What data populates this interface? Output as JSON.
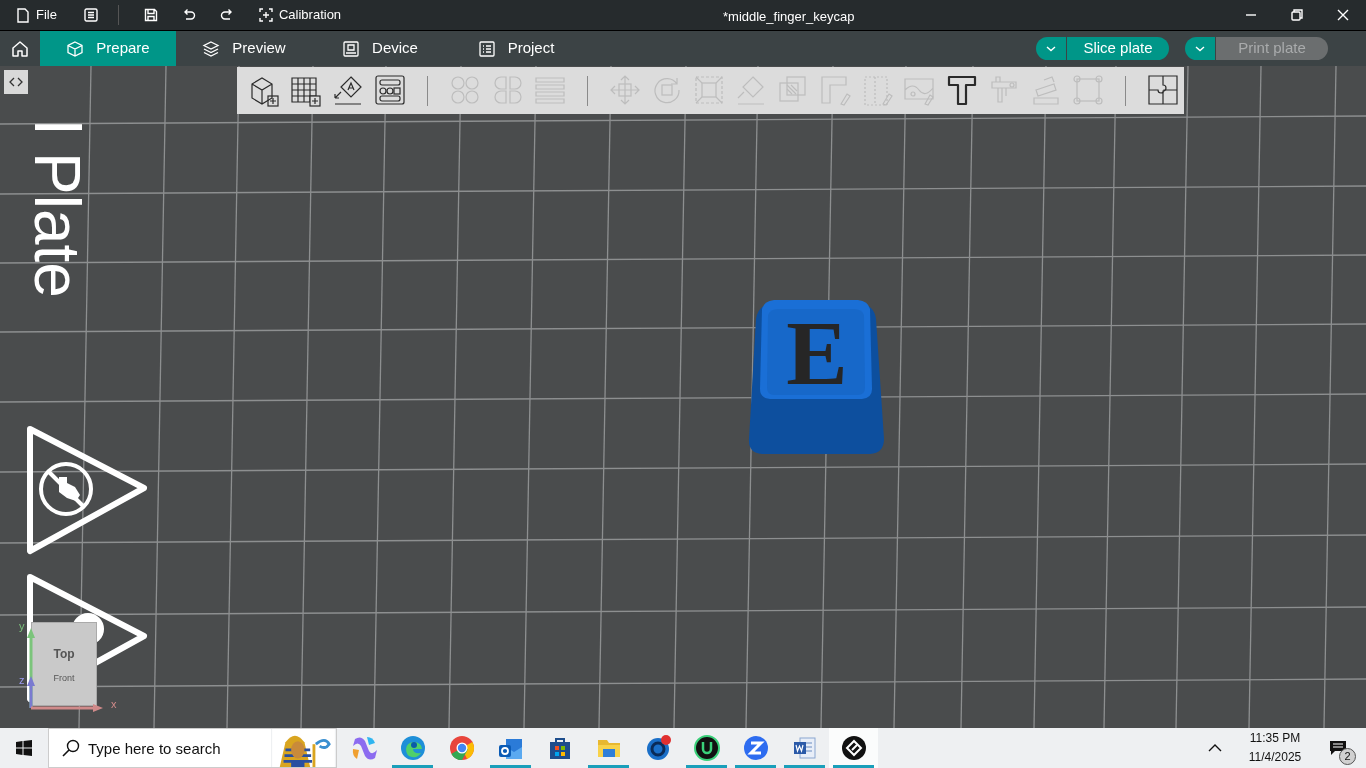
{
  "title_bar": {
    "file_menu": "File",
    "calibration": "Calibration",
    "document_title": "*middle_finger_keycap"
  },
  "tabs": [
    {
      "label": "Prepare",
      "selected": true
    },
    {
      "label": "Preview",
      "selected": false
    },
    {
      "label": "Device",
      "selected": false
    },
    {
      "label": "Project",
      "selected": false
    }
  ],
  "actions": [
    {
      "label": "Slice plate",
      "disabled": false
    },
    {
      "label": "Print plate",
      "disabled": true
    }
  ],
  "toolbar": {
    "groups": [
      [
        {
          "disabled": false
        },
        {
          "disabled": false
        },
        {
          "disabled": false
        },
        {
          "disabled": false
        }
      ],
      [
        {
          "disabled": true
        },
        {
          "disabled": true
        },
        {
          "disabled": true
        }
      ],
      [
        {
          "disabled": true
        },
        {
          "disabled": true
        },
        {
          "disabled": true
        },
        {
          "disabled": true
        },
        {
          "disabled": true
        },
        {
          "disabled": true
        },
        {
          "disabled": true
        },
        {
          "disabled": true
        },
        {
          "disabled": false
        },
        {
          "disabled": true
        },
        {
          "disabled": true
        },
        {
          "disabled": true
        }
      ],
      [
        {
          "disabled": false
        }
      ]
    ]
  },
  "viewport": {
    "plate_label": "l Plate",
    "keycap_legend": "E",
    "nav_cube": {
      "top": "Top",
      "front": "Front",
      "x_axis": "x",
      "y_axis": "y",
      "z_axis": "z"
    }
  },
  "taskbar": {
    "search_placeholder": "Type here to search",
    "apps": [
      {
        "running": false,
        "active": false
      },
      {
        "running": true,
        "active": false
      },
      {
        "running": false,
        "active": false
      },
      {
        "running": true,
        "active": false
      },
      {
        "running": false,
        "active": false
      },
      {
        "running": true,
        "active": false
      },
      {
        "running": false,
        "active": false
      },
      {
        "running": true,
        "active": false
      },
      {
        "running": true,
        "active": false
      },
      {
        "running": true,
        "active": false
      },
      {
        "running": true,
        "active": true
      }
    ],
    "time": "11:35 PM",
    "date": "11/4/2025",
    "notification_count": "2"
  }
}
